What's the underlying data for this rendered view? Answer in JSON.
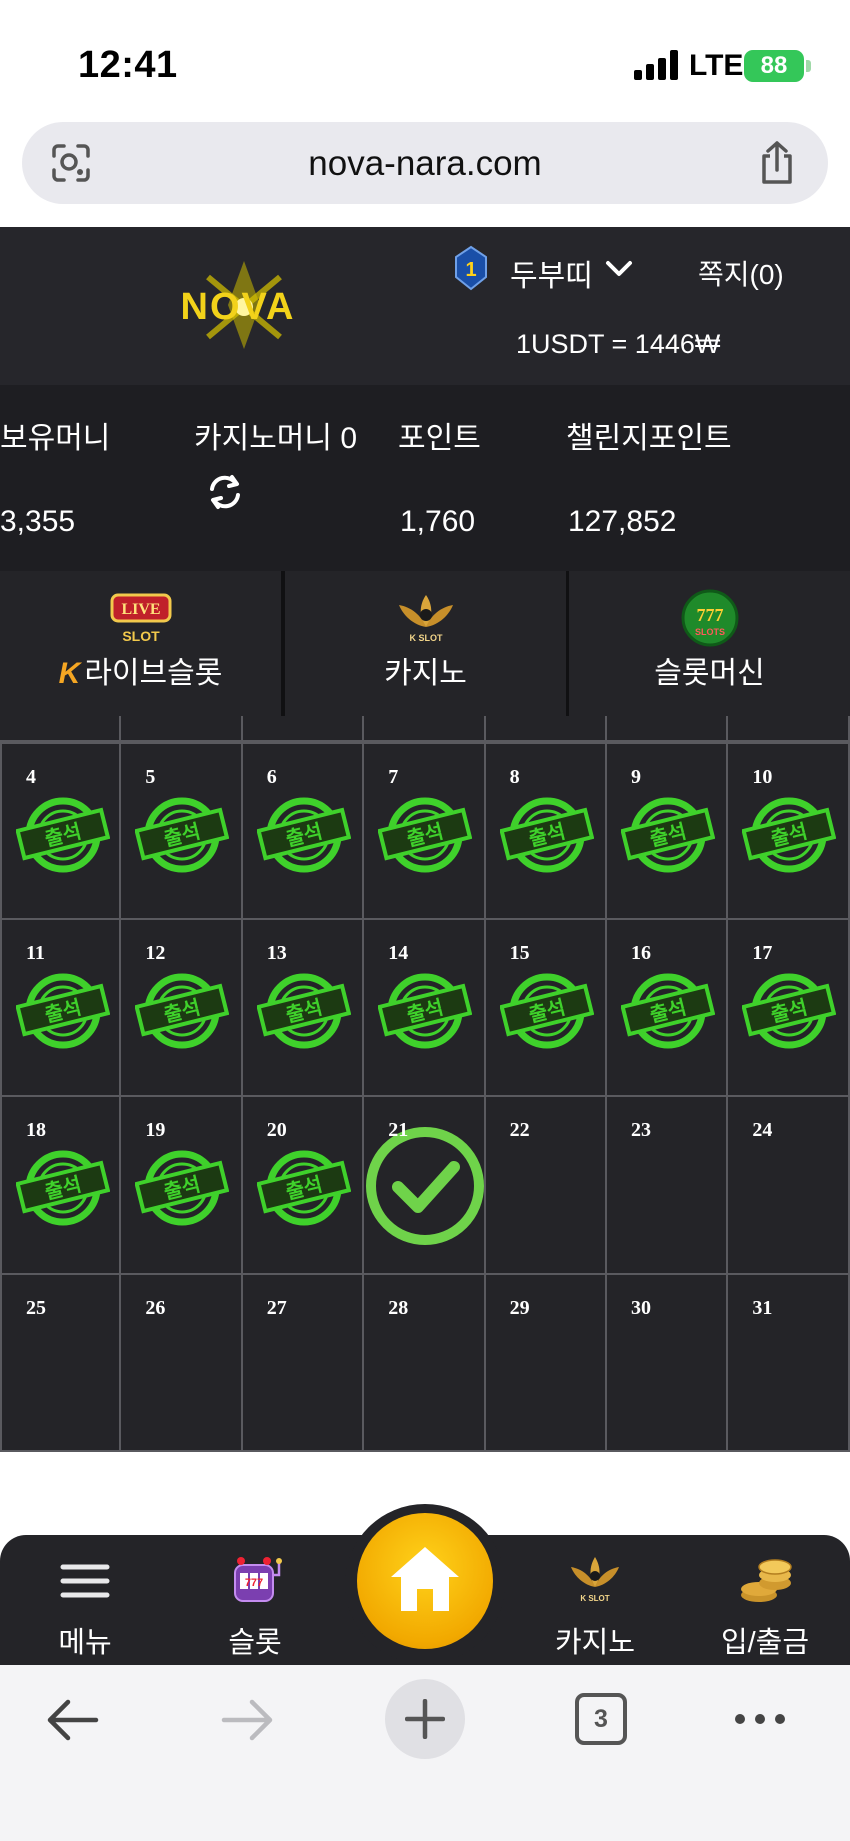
{
  "status_bar": {
    "time": "12:41",
    "network": "LTE",
    "battery": "88"
  },
  "browser": {
    "url": "nova-nara.com",
    "tab_count": "3"
  },
  "header": {
    "logo_text": "NOVA",
    "rank": "1",
    "username": "두부띠",
    "messages": "쪽지(0)",
    "exchange_rate": "1USDT = 1446₩"
  },
  "balance": {
    "money_label": "보유머니",
    "money_value": "3,355",
    "casino_label": "카지노머니 0",
    "point_label": "포인트",
    "point_value": "1,760",
    "challenge_label": "챌린지포인트",
    "challenge_value": "127,852"
  },
  "tabs": [
    {
      "label": "라이브슬롯",
      "icon": "live-slot-icon",
      "prefix": "K"
    },
    {
      "label": "카지노",
      "icon": "k-slot-lotus-icon"
    },
    {
      "label": "슬롯머신",
      "icon": "777-slots-icon"
    }
  ],
  "calendar": {
    "stamp_text": "출석",
    "rows": [
      [
        {
          "day": "4",
          "state": "attended"
        },
        {
          "day": "5",
          "state": "attended"
        },
        {
          "day": "6",
          "state": "attended"
        },
        {
          "day": "7",
          "state": "attended"
        },
        {
          "day": "8",
          "state": "attended"
        },
        {
          "day": "9",
          "state": "attended"
        },
        {
          "day": "10",
          "state": "attended"
        }
      ],
      [
        {
          "day": "11",
          "state": "attended"
        },
        {
          "day": "12",
          "state": "attended"
        },
        {
          "day": "13",
          "state": "attended"
        },
        {
          "day": "14",
          "state": "attended"
        },
        {
          "day": "15",
          "state": "attended"
        },
        {
          "day": "16",
          "state": "attended"
        },
        {
          "day": "17",
          "state": "attended"
        }
      ],
      [
        {
          "day": "18",
          "state": "attended"
        },
        {
          "day": "19",
          "state": "attended"
        },
        {
          "day": "20",
          "state": "attended"
        },
        {
          "day": "21",
          "state": "today"
        },
        {
          "day": "22",
          "state": "none"
        },
        {
          "day": "23",
          "state": "none"
        },
        {
          "day": "24",
          "state": "none"
        }
      ],
      [
        {
          "day": "25",
          "state": "none"
        },
        {
          "day": "26",
          "state": "none"
        },
        {
          "day": "27",
          "state": "none"
        },
        {
          "day": "28",
          "state": "none"
        },
        {
          "day": "29",
          "state": "none"
        },
        {
          "day": "30",
          "state": "none"
        },
        {
          "day": "31",
          "state": "none"
        }
      ]
    ]
  },
  "bottom_nav": [
    {
      "label": "메뉴",
      "icon": "hamburger-menu-icon"
    },
    {
      "label": "슬롯",
      "icon": "slot-machine-icon"
    },
    {
      "label": "",
      "icon": "home-icon"
    },
    {
      "label": "카지노",
      "icon": "k-slot-lotus-icon"
    },
    {
      "label": "입/출금",
      "icon": "coins-icon"
    }
  ],
  "colors": {
    "stamp_green": "#3fd12b",
    "home_gold": "#f2a900",
    "panel": "#242428"
  }
}
